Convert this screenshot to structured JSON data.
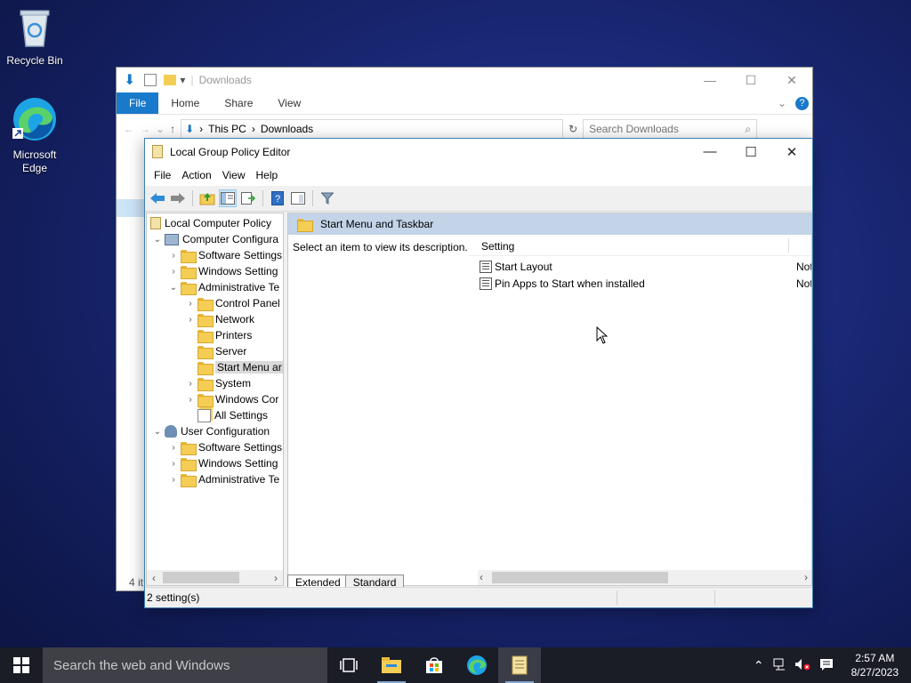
{
  "desktop": {
    "icons": [
      {
        "label": "Recycle Bin"
      },
      {
        "label_line1": "Microsoft",
        "label_line2": "Edge"
      }
    ]
  },
  "explorer": {
    "title": "Downloads",
    "ribbon_tabs": [
      "File",
      "Home",
      "Share",
      "View"
    ],
    "breadcrumb": [
      "This PC",
      "Downloads"
    ],
    "search_placeholder": "Search Downloads",
    "status_partial": "4 it"
  },
  "gpe": {
    "title": "Local Group Policy Editor",
    "menu": [
      "File",
      "Action",
      "View",
      "Help"
    ],
    "tree": {
      "root": "Local Computer Policy",
      "computer_config": "Computer Configura",
      "software_settings": "Software Settings",
      "windows_settings": "Windows Setting",
      "admin_templates": "Administrative Te",
      "control_panel": "Control Panel",
      "network": "Network",
      "printers": "Printers",
      "server": "Server",
      "start_menu": "Start Menu ar",
      "system": "System",
      "windows_components": "Windows Cor",
      "all_settings": "All Settings",
      "user_config": "User Configuration",
      "user_software": "Software Settings",
      "user_windows": "Windows Setting",
      "user_admin": "Administrative Te"
    },
    "right": {
      "header": "Start Menu and Taskbar",
      "description": "Select an item to view its description.",
      "column_setting": "Setting",
      "rows": [
        {
          "name": "Start Layout",
          "state": "Not"
        },
        {
          "name": "Pin Apps to Start when installed",
          "state": "Not"
        }
      ]
    },
    "tabs": [
      "Extended",
      "Standard"
    ],
    "status": "2 setting(s)"
  },
  "taskbar": {
    "search_placeholder": "Search the web and Windows",
    "time": "2:57 AM",
    "date": "8/27/2023"
  },
  "colors": {
    "accent": "#1979ca",
    "desktop": "#1b2a7a",
    "taskbar": "#1a1c26"
  }
}
